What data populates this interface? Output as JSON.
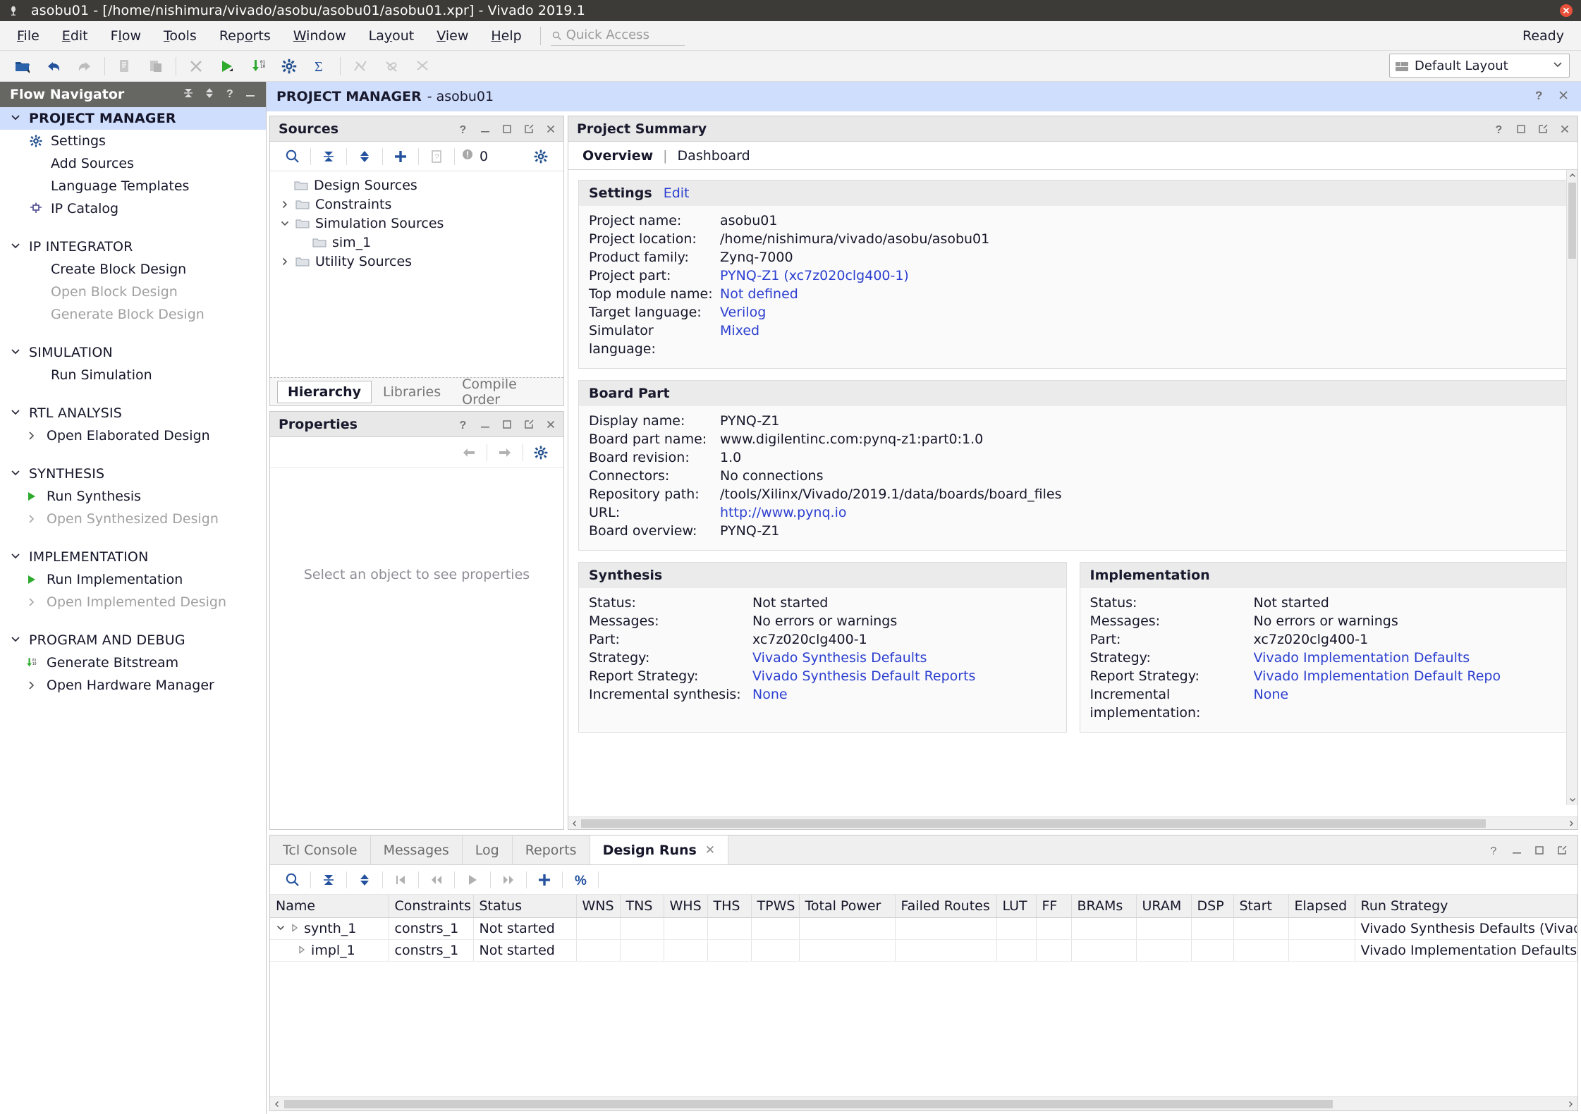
{
  "window": {
    "title": "asobu01 - [/home/nishimura/vivado/asobu/asobu01/asobu01.xpr] - Vivado 2019.1",
    "close_label": "✕"
  },
  "menubar": {
    "items": [
      "File",
      "Edit",
      "Flow",
      "Tools",
      "Reports",
      "Window",
      "Layout",
      "View",
      "Help"
    ],
    "quick_access_placeholder": "Quick Access",
    "status": "Ready"
  },
  "toolbar": {
    "layout_value": "Default Layout",
    "buttons": [
      "open-project-icon",
      "undo-icon",
      "redo-icon",
      "copy-icon",
      "paste-icon",
      "delete-icon",
      "run-icon",
      "generate-bitstream-icon",
      "settings-icon",
      "sigma-icon",
      "disabled-report-icon",
      "disabled-marker-icon",
      "disabled-cut-icon"
    ]
  },
  "flow_navigator": {
    "title": "Flow Navigator",
    "sections": [
      {
        "name": "PROJECT MANAGER",
        "active": true,
        "items": [
          {
            "label": "Settings",
            "icon": "gear-icon",
            "disabled": false
          },
          {
            "label": "Add Sources",
            "icon": "",
            "disabled": false
          },
          {
            "label": "Language Templates",
            "icon": "",
            "disabled": false
          },
          {
            "label": "IP Catalog",
            "icon": "ip-catalog-icon",
            "disabled": false
          }
        ]
      },
      {
        "name": "IP INTEGRATOR",
        "active": false,
        "items": [
          {
            "label": "Create Block Design",
            "icon": "",
            "disabled": false
          },
          {
            "label": "Open Block Design",
            "icon": "",
            "disabled": true
          },
          {
            "label": "Generate Block Design",
            "icon": "",
            "disabled": true
          }
        ]
      },
      {
        "name": "SIMULATION",
        "active": false,
        "items": [
          {
            "label": "Run Simulation",
            "icon": "",
            "disabled": false
          }
        ]
      },
      {
        "name": "RTL ANALYSIS",
        "active": false,
        "items": [
          {
            "label": "Open Elaborated Design",
            "icon": "chevron-right-icon",
            "disabled": false
          }
        ]
      },
      {
        "name": "SYNTHESIS",
        "active": false,
        "items": [
          {
            "label": "Run Synthesis",
            "icon": "play-icon",
            "disabled": false
          },
          {
            "label": "Open Synthesized Design",
            "icon": "chevron-right-icon",
            "disabled": true
          }
        ]
      },
      {
        "name": "IMPLEMENTATION",
        "active": false,
        "items": [
          {
            "label": "Run Implementation",
            "icon": "play-icon",
            "disabled": false
          },
          {
            "label": "Open Implemented Design",
            "icon": "chevron-right-icon",
            "disabled": true
          }
        ]
      },
      {
        "name": "PROGRAM AND DEBUG",
        "active": false,
        "items": [
          {
            "label": "Generate Bitstream",
            "icon": "generate-bitstream-icon",
            "disabled": false
          },
          {
            "label": "Open Hardware Manager",
            "icon": "chevron-right-icon",
            "disabled": false
          }
        ]
      }
    ]
  },
  "project_manager_bar": {
    "title": "PROJECT MANAGER",
    "project": "- asobu01"
  },
  "sources_panel": {
    "title": "Sources",
    "message_count": "0",
    "tree": [
      {
        "label": "Design Sources",
        "indent": 1,
        "arrow": "none"
      },
      {
        "label": "Constraints",
        "indent": 1,
        "arrow": "collapsed"
      },
      {
        "label": "Simulation Sources",
        "indent": 1,
        "arrow": "expanded"
      },
      {
        "label": "sim_1",
        "indent": 2,
        "arrow": "none"
      },
      {
        "label": "Utility Sources",
        "indent": 1,
        "arrow": "collapsed"
      }
    ],
    "tabs": [
      {
        "label": "Hierarchy",
        "selected": true
      },
      {
        "label": "Libraries",
        "selected": false
      },
      {
        "label": "Compile Order",
        "selected": false
      }
    ]
  },
  "properties_panel": {
    "title": "Properties",
    "empty_text": "Select an object to see properties"
  },
  "project_summary": {
    "title": "Project Summary",
    "tabs": [
      {
        "label": "Overview",
        "selected": true
      },
      {
        "label": "Dashboard",
        "selected": false
      }
    ],
    "settings": {
      "heading": "Settings",
      "edit_label": "Edit",
      "rows": [
        {
          "key": "Project name:",
          "value": "asobu01",
          "link": false
        },
        {
          "key": "Project location:",
          "value": "/home/nishimura/vivado/asobu/asobu01",
          "link": false
        },
        {
          "key": "Product family:",
          "value": "Zynq-7000",
          "link": false
        },
        {
          "key": "Project part:",
          "value": "PYNQ-Z1 (xc7z020clg400-1)",
          "link": true
        },
        {
          "key": "Top module name:",
          "value": "Not defined",
          "link": true
        },
        {
          "key": "Target language:",
          "value": "Verilog",
          "link": true
        },
        {
          "key": "Simulator language:",
          "value": "Mixed",
          "link": true
        }
      ]
    },
    "board_part": {
      "heading": "Board Part",
      "rows": [
        {
          "key": "Display name:",
          "value": "PYNQ-Z1",
          "link": false
        },
        {
          "key": "Board part name:",
          "value": "www.digilentinc.com:pynq-z1:part0:1.0",
          "link": false
        },
        {
          "key": "Board revision:",
          "value": "1.0",
          "link": false
        },
        {
          "key": "Connectors:",
          "value": "No connections",
          "link": false
        },
        {
          "key": "Repository path:",
          "value": "/tools/Xilinx/Vivado/2019.1/data/boards/board_files",
          "link": false
        },
        {
          "key": "URL:",
          "value": "http://www.pynq.io",
          "link": true
        },
        {
          "key": "Board overview:",
          "value": "PYNQ-Z1",
          "link": false
        }
      ]
    },
    "synthesis": {
      "heading": "Synthesis",
      "rows": [
        {
          "key": "Status:",
          "value": "Not started",
          "link": false
        },
        {
          "key": "Messages:",
          "value": "No errors or warnings",
          "link": false
        },
        {
          "key": "Part:",
          "value": "xc7z020clg400-1",
          "link": false
        },
        {
          "key": "Strategy:",
          "value": "Vivado Synthesis Defaults",
          "link": true
        },
        {
          "key": "Report Strategy:",
          "value": "Vivado Synthesis Default Reports",
          "link": true
        },
        {
          "key": "Incremental synthesis:",
          "value": "None",
          "link": true
        }
      ]
    },
    "implementation": {
      "heading": "Implementation",
      "rows": [
        {
          "key": "Status:",
          "value": "Not started",
          "link": false
        },
        {
          "key": "Messages:",
          "value": "No errors or warnings",
          "link": false
        },
        {
          "key": "Part:",
          "value": "xc7z020clg400-1",
          "link": false
        },
        {
          "key": "Strategy:",
          "value": "Vivado Implementation Defaults",
          "link": true
        },
        {
          "key": "Report Strategy:",
          "value": "Vivado Implementation Default Repo",
          "link": true
        },
        {
          "key": "Incremental implementation:",
          "value": "None",
          "link": true
        }
      ]
    }
  },
  "bottom_panel": {
    "tabs": [
      {
        "label": "Tcl Console",
        "selected": false,
        "closable": false
      },
      {
        "label": "Messages",
        "selected": false,
        "closable": false
      },
      {
        "label": "Log",
        "selected": false,
        "closable": false
      },
      {
        "label": "Reports",
        "selected": false,
        "closable": false
      },
      {
        "label": "Design Runs",
        "selected": true,
        "closable": true
      }
    ],
    "close_glyph": "✕",
    "columns": [
      "Name",
      "Constraints",
      "Status",
      "WNS",
      "TNS",
      "WHS",
      "THS",
      "TPWS",
      "Total Power",
      "Failed Routes",
      "LUT",
      "FF",
      "BRAMs",
      "URAM",
      "DSP",
      "Start",
      "Elapsed",
      "Run Strategy"
    ],
    "rows": [
      {
        "indent": 0,
        "expander": "expanded",
        "name": "synth_1",
        "constraints": "constrs_1",
        "status": "Not started",
        "wns": "",
        "tns": "",
        "whs": "",
        "ths": "",
        "tpws": "",
        "total_power": "",
        "failed_routes": "",
        "lut": "",
        "ff": "",
        "brams": "",
        "uram": "",
        "dsp": "",
        "start": "",
        "elapsed": "",
        "run_strategy": "Vivado Synthesis Defaults (Vivado Sy"
      },
      {
        "indent": 1,
        "expander": "leaf",
        "name": "impl_1",
        "constraints": "constrs_1",
        "status": "Not started",
        "wns": "",
        "tns": "",
        "whs": "",
        "ths": "",
        "tpws": "",
        "total_power": "",
        "failed_routes": "",
        "lut": "",
        "ff": "",
        "brams": "",
        "uram": "",
        "dsp": "",
        "start": "",
        "elapsed": "",
        "run_strategy": "Vivado Implementation Defaults (Viva"
      }
    ]
  },
  "colors": {
    "accent_blue": "#2c3fd0",
    "titlebar": "#3c3b37",
    "header_highlight": "#cfdefc",
    "flownav_header": "#666663",
    "green": "#2eaa2e"
  }
}
